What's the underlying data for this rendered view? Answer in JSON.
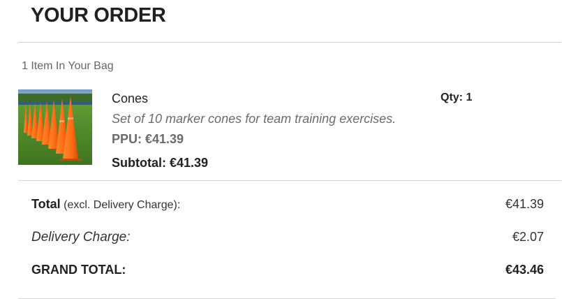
{
  "header": {
    "title": "YOUR ORDER"
  },
  "bag": {
    "count_text": "1 Item In Your Bag"
  },
  "items": [
    {
      "name": "Cones",
      "description": "Set of 10 marker cones for team training exercises.",
      "ppu_text": "PPU: €41.39",
      "subtotal_text": "Subtotal: €41.39",
      "qty_text": "Qty: 1",
      "image": "orange-cones-photo"
    }
  ],
  "summary": {
    "total_label": "Total",
    "total_note": " (excl. Delivery Charge):",
    "total_amount": "€41.39",
    "delivery_label": "Delivery Charge:",
    "delivery_amount": "€2.07",
    "grand_label": "GRAND TOTAL:",
    "grand_amount": "€43.46"
  },
  "colors": {
    "cone": "#ff6a13",
    "grass": "#4f8a2a",
    "rule": "#d4d4d4"
  }
}
